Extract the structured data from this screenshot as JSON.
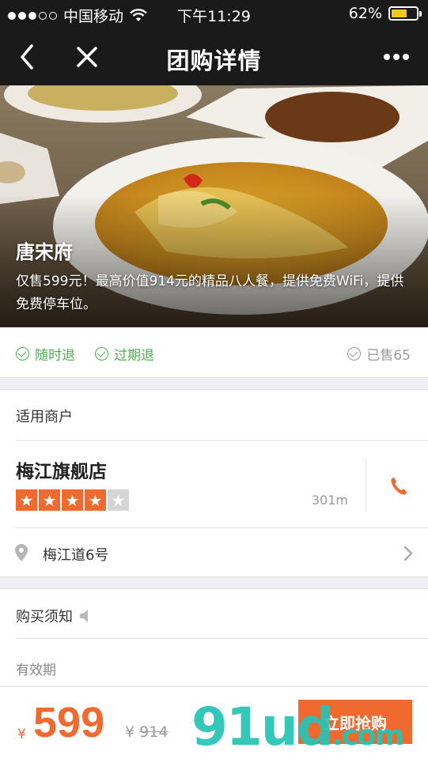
{
  "status_bar": {
    "carrier": "中国移动",
    "time": "下午11:29",
    "battery": "62%",
    "battery_level": 0.62
  },
  "nav": {
    "title": "团购详情",
    "back_icon": "chevron-left-icon",
    "close_icon": "close-icon",
    "more_icon": "more-dots-icon"
  },
  "deal": {
    "title": "唐宋府",
    "description": "仅售599元！最高价值914元的精品八人餐，提供免费WiFi，提供免费停车位。"
  },
  "refund": {
    "anytime": "随时退",
    "expired": "过期退",
    "sold": "已售65"
  },
  "merchant": {
    "section_title": "适用商户",
    "name": "梅江旗舰店",
    "rating": 4,
    "rating_max": 5,
    "distance": "301m",
    "address": "梅江道6号"
  },
  "notice": {
    "title": "购买须知",
    "validity_label": "有效期"
  },
  "bottom": {
    "currency": "¥",
    "price": "599",
    "original_currency": "¥",
    "original_price": "914",
    "buy_label": "立即抢购"
  },
  "watermark": {
    "brand": "91ud",
    "domain": ".com"
  },
  "colors": {
    "accent": "#f06a2f",
    "green": "#4cb050",
    "bar_dark": "#1a1a1a"
  }
}
